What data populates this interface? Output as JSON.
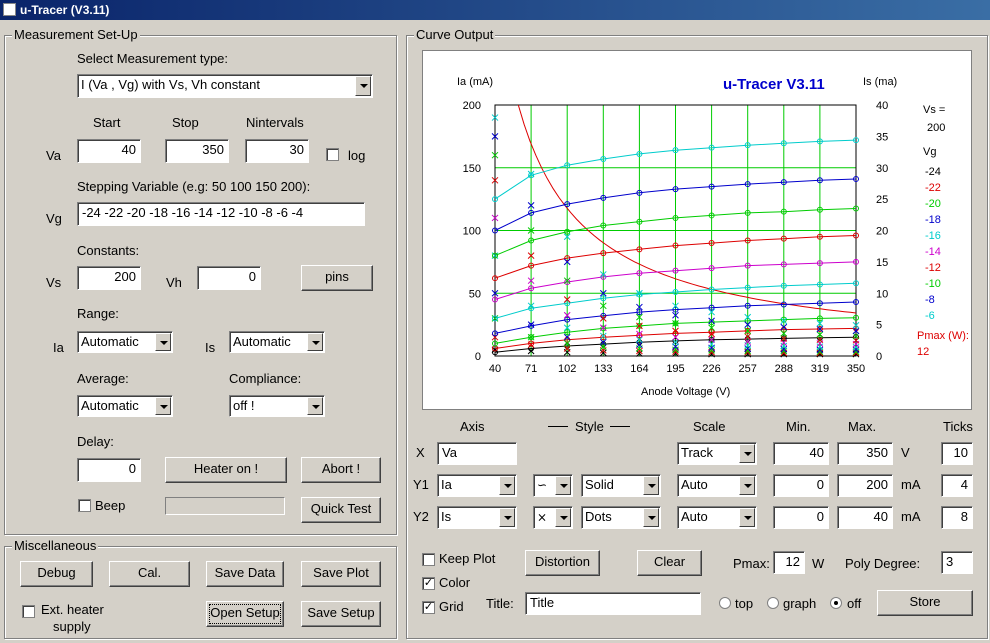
{
  "window": {
    "title": "u-Tracer (V3.11)"
  },
  "setup": {
    "group_label": "Measurement Set-Up",
    "measure_type_label": "Select Measurement type:",
    "measure_type_value": "I (Va , Vg) with Vs, Vh constant",
    "start_label": "Start",
    "stop_label": "Stop",
    "nintervals_label": "Nintervals",
    "va_label": "Va",
    "va_start": "40",
    "va_stop": "350",
    "va_nint": "30",
    "log_label": "log",
    "stepping_label": "Stepping Variable (e.g: 50 100 150 200):",
    "vg_label": "Vg",
    "vg_value": "-24 -22 -20 -18 -16 -14 -12 -10 -8 -6 -4",
    "constants_label": "Constants:",
    "vs_label": "Vs",
    "vs_value": "200",
    "vh_label": "Vh",
    "vh_value": "0",
    "pins_label": "pins",
    "range_label": "Range:",
    "ia_label": "Ia",
    "ia_range": "Automatic",
    "is_label": "Is",
    "is_range": "Automatic",
    "average_label": "Average:",
    "average_value": "Automatic",
    "compliance_label": "Compliance:",
    "compliance_value": "off !",
    "delay_label": "Delay:",
    "delay_value": "0",
    "heater_label": "Heater on !",
    "abort_label": "Abort !",
    "beep_label": "Beep",
    "quicktest_label": "Quick Test"
  },
  "misc": {
    "group_label": "Miscellaneous",
    "debug_label": "Debug",
    "cal_label": "Cal.",
    "savedata_label": "Save Data",
    "saveplot_label": "Save Plot",
    "extheater_label1": "Ext. heater",
    "extheater_label2": "supply",
    "opensetup_label": "Open Setup",
    "savesetup_label": "Save Setup"
  },
  "curve": {
    "group_label": "Curve Output",
    "axis_hdr": "Axis",
    "style_hdr": "Style",
    "scale_hdr": "Scale",
    "min_hdr": "Min.",
    "max_hdr": "Max.",
    "ticks_hdr": "Ticks",
    "rows": [
      {
        "axis": "X",
        "var": "Va",
        "style_icon": "",
        "style": "",
        "scale": "Track",
        "min": "40",
        "max": "350",
        "unit": "V",
        "ticks": "10"
      },
      {
        "axis": "Y1",
        "var": "Ia",
        "style_icon": "line-marker-icon",
        "style": "Solid",
        "scale": "Auto",
        "min": "0",
        "max": "200",
        "unit": "mA",
        "ticks": "4"
      },
      {
        "axis": "Y2",
        "var": "Is",
        "style_icon": "cross-marker-icon",
        "style": "Dots",
        "scale": "Auto",
        "min": "0",
        "max": "40",
        "unit": "mA",
        "ticks": "8"
      }
    ],
    "keepplot_label": "Keep Plot",
    "distortion_label": "Distortion",
    "clear_label": "Clear",
    "pmax_label": "Pmax:",
    "pmax_value": "12",
    "pmax_unit": "W",
    "polydeg_label": "Poly Degree:",
    "polydeg_value": "3",
    "color_label": "Color",
    "grid_label": "Grid",
    "title_label": "Title:",
    "title_value": "Title",
    "top_label": "top",
    "graph_label": "graph",
    "off_label": "off",
    "store_label": "Store"
  },
  "colors": {
    "accent": "#0a246a",
    "face": "#d4d0c8"
  },
  "chart_data": {
    "type": "line",
    "title": "u-Tracer V3.11",
    "ylabel": "Ia (mA)",
    "y2label": "Is (ma)",
    "xlabel": "Anode Voltage (V)",
    "xlim": [
      40,
      350
    ],
    "ylim": [
      0,
      200
    ],
    "y2lim": [
      0,
      40
    ],
    "grid": true,
    "xticks": [
      "40",
      "71",
      "102",
      "133",
      "164",
      "195",
      "226",
      "257",
      "288",
      "319",
      "350"
    ],
    "yticks": [
      "0",
      "50",
      "100",
      "150",
      "200"
    ],
    "y2ticks": [
      "0",
      "5",
      "10",
      "15",
      "20",
      "25",
      "30",
      "35",
      "40"
    ],
    "legend_header": [
      "Vs =",
      "200",
      "Vg"
    ],
    "pmax_legend": [
      "Pmax (W):",
      "12"
    ],
    "series": [
      {
        "name": "-24",
        "color": "#000000",
        "ia": [
          3,
          6,
          8,
          9.5,
          11,
          12,
          13,
          13.5,
          14,
          14.5,
          15
        ],
        "is": [
          1,
          0.8,
          0.6,
          0.5,
          0.4,
          0.4,
          0.3,
          0.3,
          0.3,
          0.3,
          0.3
        ]
      },
      {
        "name": "-22",
        "color": "#dd0000",
        "ia": [
          6,
          10,
          13,
          15,
          16.5,
          18,
          19,
          20,
          21,
          21.5,
          22
        ],
        "is": [
          3,
          1.8,
          1.2,
          0.9,
          0.8,
          0.7,
          0.6,
          0.6,
          0.5,
          0.5,
          0.5
        ]
      },
      {
        "name": "-20",
        "color": "#00cc00",
        "ia": [
          10,
          15,
          19,
          22,
          24,
          26,
          27,
          28,
          29,
          30,
          30.5
        ],
        "is": [
          6,
          3,
          2,
          1.5,
          1.2,
          1,
          0.9,
          0.8,
          0.8,
          0.7,
          0.7
        ]
      },
      {
        "name": "-18",
        "color": "#0000cc",
        "ia": [
          18,
          24,
          29,
          32,
          35,
          37,
          38.5,
          40,
          41,
          42,
          43
        ],
        "is": [
          10,
          5,
          3,
          2.2,
          1.8,
          1.5,
          1.3,
          1.2,
          1.1,
          1,
          1
        ]
      },
      {
        "name": "-16",
        "color": "#00cccc",
        "ia": [
          30,
          38,
          42,
          46,
          49,
          51,
          53,
          54.5,
          56,
          57,
          58
        ],
        "is": [
          16,
          8,
          4.5,
          3.2,
          2.6,
          2.2,
          1.9,
          1.7,
          1.6,
          1.5,
          1.4
        ]
      },
      {
        "name": "-14",
        "color": "#cc00cc",
        "ia": [
          45,
          54,
          59,
          63,
          66,
          68,
          70,
          72,
          73,
          74,
          75
        ],
        "is": [
          22,
          12,
          6.5,
          4.5,
          3.5,
          3,
          2.6,
          2.3,
          2.1,
          2,
          1.9
        ]
      },
      {
        "name": "-12",
        "color": "#dd0000",
        "ia": [
          62,
          72,
          78,
          82,
          85,
          88,
          90,
          92,
          93.5,
          95,
          96
        ],
        "is": [
          28,
          16,
          9,
          6,
          4.8,
          4,
          3.5,
          3.1,
          2.8,
          2.6,
          2.5
        ]
      },
      {
        "name": "-10",
        "color": "#00cc00",
        "ia": [
          80,
          92,
          99,
          104,
          107,
          110,
          112,
          114,
          115,
          116.5,
          117.5
        ],
        "is": [
          32,
          20,
          12,
          8,
          6.2,
          5.2,
          4.5,
          4,
          3.6,
          3.4,
          3.2
        ]
      },
      {
        "name": "-8",
        "color": "#0000cc",
        "ia": [
          100,
          114,
          121,
          126,
          130,
          133,
          135,
          137,
          138.5,
          140,
          141
        ],
        "is": [
          35,
          24,
          15,
          10,
          7.8,
          6.5,
          5.6,
          5,
          4.6,
          4.3,
          4
        ]
      },
      {
        "name": "-6",
        "color": "#00cccc",
        "ia": [
          125,
          144,
          152,
          157,
          161,
          164,
          166,
          168,
          169.5,
          171,
          172
        ],
        "is": [
          38,
          29,
          19,
          13,
          10,
          8,
          7,
          6.2,
          5.6,
          5.2,
          4.9
        ]
      }
    ]
  }
}
